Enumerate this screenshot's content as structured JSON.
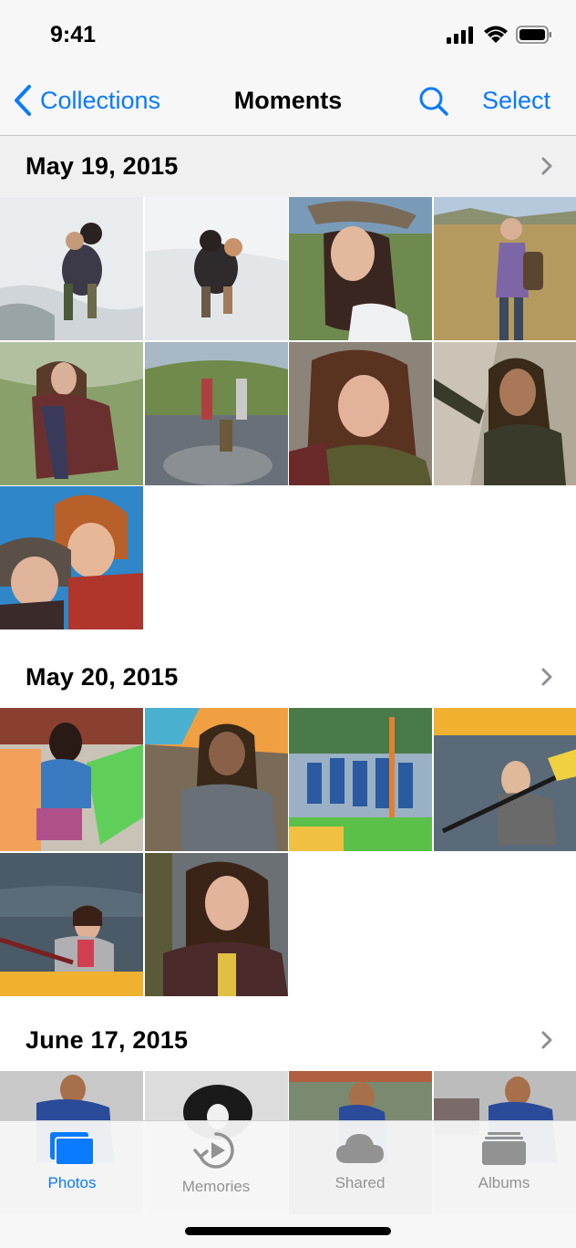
{
  "status_bar": {
    "time": "9:41",
    "icons": [
      "cellular-signal-icon",
      "wifi-icon",
      "battery-icon"
    ]
  },
  "nav_bar": {
    "back_label": "Collections",
    "title": "Moments",
    "search_icon": "search-icon",
    "select_label": "Select"
  },
  "sections": [
    {
      "date": "May 19, 2015",
      "photo_count": 9,
      "photos": [
        "beach-couple-piggyback",
        "beach-couple-piggyback-2",
        "woman-in-hat-smiling",
        "woman-with-backpack-field",
        "woman-walking-grass",
        "group-on-rocks",
        "woman-portrait",
        "man-with-dreadlocks",
        "couple-selfie"
      ]
    },
    {
      "date": "May 20, 2015",
      "photo_count": 6,
      "photos": [
        "woman-with-kayak",
        "man-with-dreadlocks-kayaks",
        "group-with-paddles",
        "man-kayaking",
        "woman-kayaking",
        "woman-smiling-dock"
      ]
    },
    {
      "date": "June 17, 2015",
      "photo_count": 4,
      "photos": [
        "boy-outdoors",
        "dog",
        "boy-garden",
        "boy-with-friends"
      ]
    }
  ],
  "tab_bar": {
    "tabs": [
      {
        "label": "Photos",
        "icon": "photos-icon",
        "active": true
      },
      {
        "label": "Memories",
        "icon": "memories-icon",
        "active": false
      },
      {
        "label": "Shared",
        "icon": "cloud-icon",
        "active": false
      },
      {
        "label": "Albums",
        "icon": "albums-icon",
        "active": false
      }
    ]
  },
  "colors": {
    "accent": "#0a7aff",
    "inactive_tab": "#929292"
  }
}
